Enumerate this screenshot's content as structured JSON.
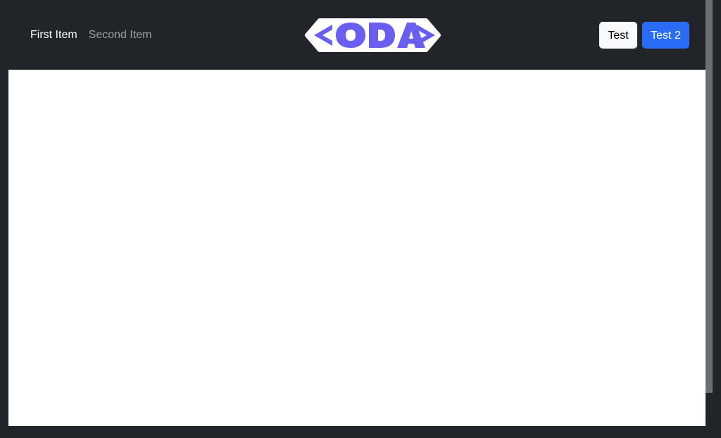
{
  "navbar": {
    "links": [
      {
        "label": "First Item",
        "active": true
      },
      {
        "label": "Second Item",
        "active": false
      }
    ],
    "logo_text": "<ODA>",
    "buttons": {
      "light_label": "Test",
      "primary_label": "Test 2"
    }
  },
  "colors": {
    "navbar_bg": "#212529",
    "logo_fill": "#6a5ef0",
    "primary": "#2b6cf6",
    "light": "#f8f9fa"
  }
}
